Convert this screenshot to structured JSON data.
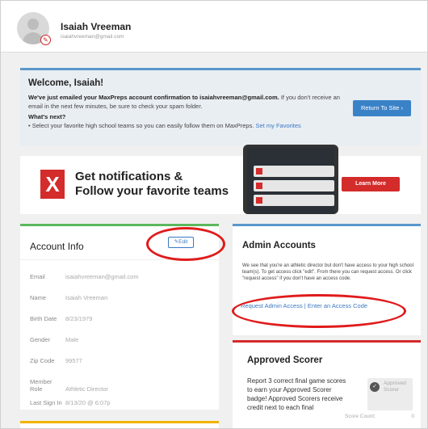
{
  "user": {
    "name": "Isaiah Vreeman",
    "email": "isaiahvreeman@gmail.com"
  },
  "welcome": {
    "title": "Welcome, Isaiah!",
    "msg_bold": "We've just emailed your MaxPreps account confirmation to isaiahvreeman@gmail.com.",
    "msg_rest": " If you don't receive an email in the next few minutes, be sure to check your spam folder.",
    "next_label": "What's next?",
    "bullet_text": "• Select your favorite high school teams so you can easily follow them on MaxPreps.",
    "bullet_link": "Set my Favorites",
    "return_button": "Return To Site ›"
  },
  "promo": {
    "logo_letter": "X",
    "title_line1": "Get notifications &",
    "title_line2": "Follow your favorite teams",
    "learn_button": "Learn More"
  },
  "account": {
    "title": "Account Info",
    "edit_button": "✎Edit",
    "rows": [
      {
        "label": "Email",
        "value": "isaiahvreeman@gmail.com"
      },
      {
        "label": "Name",
        "value": "Isaiah Vreeman"
      },
      {
        "label": "Birth Date",
        "value": "8/23/1979"
      },
      {
        "label": "Gender",
        "value": "Male"
      },
      {
        "label": "Zip Code",
        "value": "99577"
      },
      {
        "label": "Member Role",
        "value": "Athletic Director"
      },
      {
        "label": "Last Sign In",
        "value": "8/13/20 @ 6:07p"
      }
    ]
  },
  "admin": {
    "title": "Admin Accounts",
    "text": "We see that you're an athletic director but don't have access to your high school team(s). To get access click \"edit\". From there you can request access. Or click \"request access\" if you don't have an access code.",
    "link_request": "Request Admin Access",
    "link_sep": " | ",
    "link_enter": "Enter an Access Code"
  },
  "scorer": {
    "title": "Approved Scorer",
    "text": "Report 3 correct final game scores to earn your Approved Scorer badge! Approved Scorers receive credit next to each final",
    "badge_label": "Approved Scorer",
    "count_label": "Score Count:",
    "count_value": "0"
  },
  "colors": {
    "accent_blue": "#3a78c2",
    "brand_red": "#d42b2b",
    "annotation_red": "#e01b1b",
    "green": "#5cb85c"
  }
}
